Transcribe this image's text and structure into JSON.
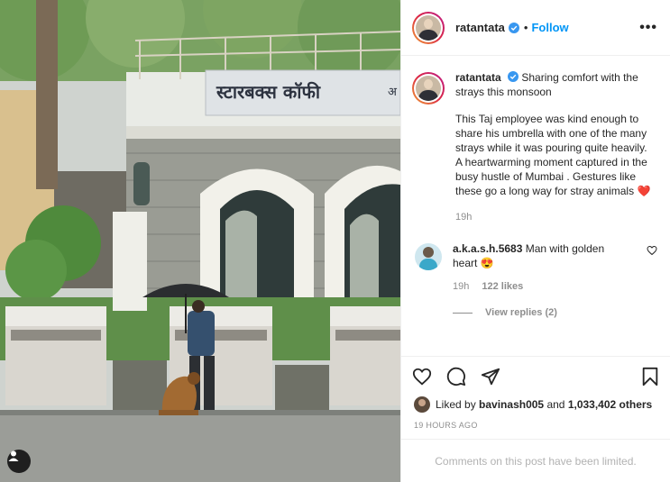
{
  "header": {
    "username": "ratantata",
    "separator": "•",
    "follow_label": "Follow",
    "more_label": "•••"
  },
  "caption": {
    "username": "ratantata",
    "line1": "Sharing comfort with the strays this monsoon",
    "body": "This Taj employee was kind enough to share his umbrella with one of the many strays while it was pouring quite heavily. A heartwarming moment captured in the busy hustle of Mumbai . Gestures like these go a long way for stray animals",
    "heart": "❤️",
    "time": "19h"
  },
  "comment": {
    "username": "a.k.a.s.h.5683",
    "text": "Man with golden heart",
    "emoji": "😍",
    "time": "19h",
    "likes": "122 likes",
    "view_replies": "View replies (2)"
  },
  "likes": {
    "prefix": "Liked by",
    "user": "bavinash005",
    "middle": "and",
    "count": "1,033,402 others"
  },
  "time_ago": "19 HOURS AGO",
  "comments_limited": "Comments on this post have been limited.",
  "photo": {
    "signage": "स्टारबक्स कॉफी",
    "signage_cut": "अ"
  },
  "icons": {
    "verified": "verified-badge-icon",
    "more": "more-options-icon",
    "like": "heart-icon",
    "comment": "comment-icon",
    "share": "share-icon",
    "save": "bookmark-icon",
    "tag_user": "user-tag-icon"
  },
  "colors": {
    "accent": "#0095f6",
    "secondary_text": "#8e8e8e",
    "border": "#efefef",
    "heart": "#ed4956"
  }
}
